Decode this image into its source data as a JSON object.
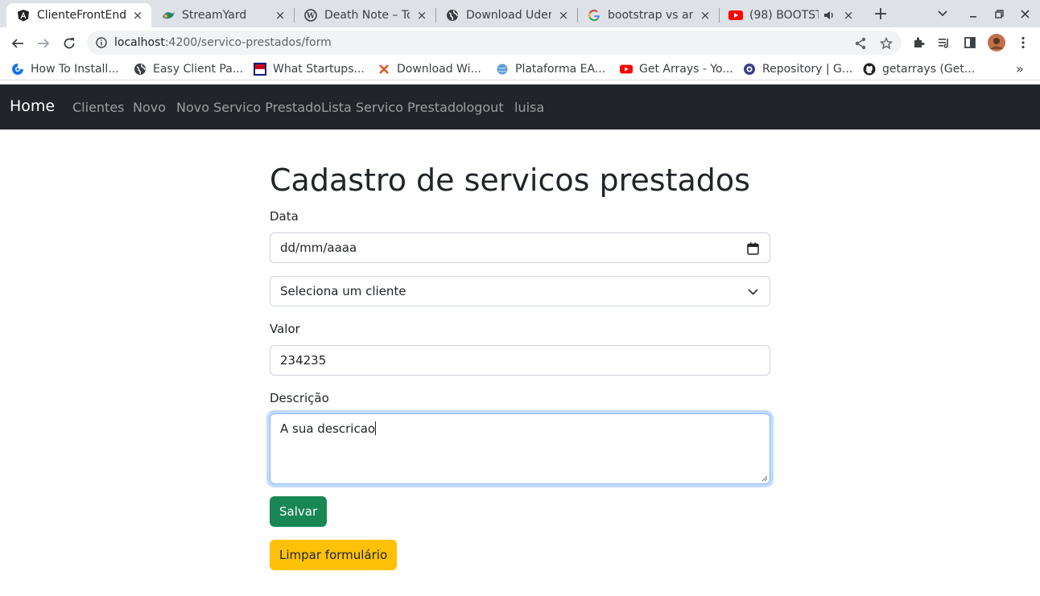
{
  "browser": {
    "tabs": [
      {
        "title": "ClienteFrontEnd",
        "icon": "angular-icon",
        "active": true
      },
      {
        "title": "StreamYard",
        "icon": "streamyard-icon"
      },
      {
        "title": "Death Note – To",
        "icon": "wordpress-icon"
      },
      {
        "title": "Download Udem",
        "icon": "globe-icon"
      },
      {
        "title": "bootstrap vs ang",
        "icon": "google-icon"
      },
      {
        "title": "(98) BOOTST",
        "icon": "youtube-icon"
      }
    ],
    "close_glyph": "×",
    "new_tab_glyph": "+",
    "url": {
      "host": "localhost",
      "path": ":4200/servico-prestados/form"
    },
    "bookmarks": [
      {
        "label": "How To Install...",
        "icon": "bookmark-icon"
      },
      {
        "label": "Easy Client Pa...",
        "icon": "globe-icon"
      },
      {
        "label": "What Startups...",
        "icon": "flag-icon"
      },
      {
        "label": "Download Wi...",
        "icon": "x-logo-icon"
      },
      {
        "label": "Plataforma EA...",
        "icon": "globe-icon"
      },
      {
        "label": "Get Arrays - Yo...",
        "icon": "youtube-icon"
      },
      {
        "label": "Repository | G...",
        "icon": "repo-icon"
      },
      {
        "label": "getarrays (Get...",
        "icon": "github-icon"
      }
    ],
    "bookmarks_more": "»"
  },
  "navbar": {
    "brand": "Home",
    "links": [
      "Clientes",
      "Novo",
      "Novo Servico Prestado",
      "Lista Servico Prestado",
      "logout",
      "luisa"
    ]
  },
  "form": {
    "title": "Cadastro de servicos prestados",
    "data_label": "Data",
    "data_value": "dd/mm/aaaa",
    "cliente_value": "Seleciona um cliente",
    "valor_label": "Valor",
    "valor_value": "234235",
    "descricao_label": "Descrição",
    "descricao_value": "A sua descricao",
    "save_label": "Salvar",
    "clear_label": "Limpar formulário"
  },
  "colors": {
    "navbar": "#212529",
    "success": "#198754",
    "warning": "#ffc107",
    "focus_ring": "#86b7fe"
  }
}
